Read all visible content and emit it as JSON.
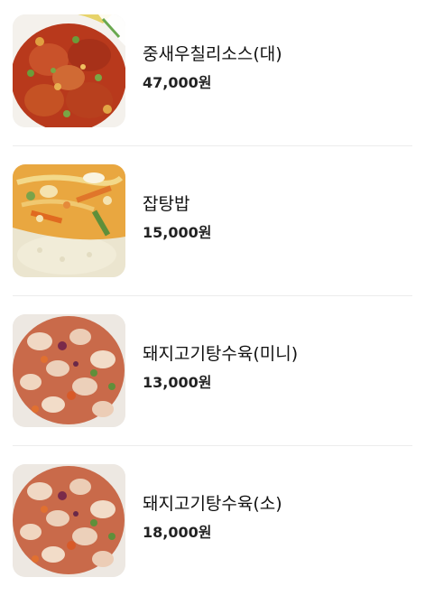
{
  "menu": {
    "items": [
      {
        "name": "중새우칠리소스(대)",
        "price": "47,000원",
        "image": "chili-shrimp-photo"
      },
      {
        "name": "잡탕밥",
        "price": "15,000원",
        "image": "japtang-rice-photo"
      },
      {
        "name": "돼지고기탕수육(미니)",
        "price": "13,000원",
        "image": "sweet-sour-pork-photo"
      },
      {
        "name": "돼지고기탕수육(소)",
        "price": "18,000원",
        "image": "sweet-sour-pork-photo"
      }
    ]
  }
}
